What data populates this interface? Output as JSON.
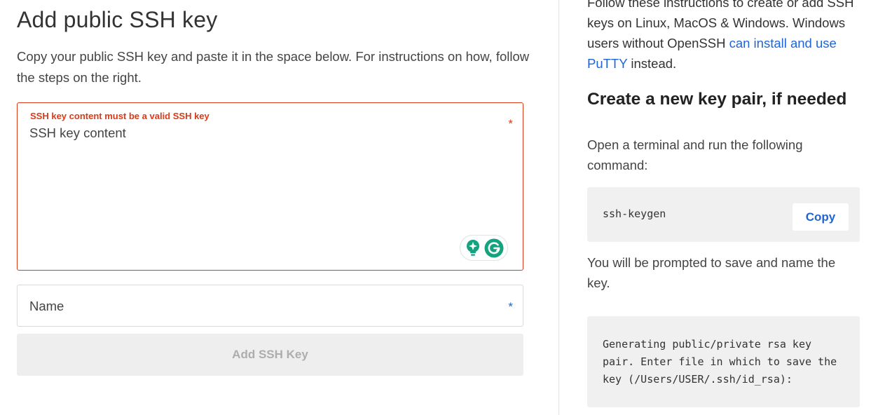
{
  "form": {
    "title": "Add public SSH key",
    "subtitle": "Copy your public SSH key and paste it in the space below. For instructions on how, follow the steps on the right.",
    "ssh_field": {
      "error": "SSH key content must be a valid SSH key",
      "placeholder": "SSH key content",
      "required_mark": "*"
    },
    "name_field": {
      "placeholder": "Name",
      "required_mark": "*"
    },
    "submit_label": "Add SSH Key"
  },
  "instructions": {
    "intro_text": "Follow these instructions to create or add SSH keys on Linux, MacOS & Windows. Windows users without OpenSSH",
    "intro_link": "can install and use PuTTY",
    "intro_suffix": "instead.",
    "section_heading": "Create a new key pair, if needed",
    "command_intro": "Open a terminal and run the following command:",
    "command": "ssh-keygen",
    "copy_label": "Copy",
    "prompt_text": "You will be prompted to save and name the key.",
    "output": "Generating public/private rsa key pair. Enter file in which to save the key (/Users/USER/.ssh/id_rsa):"
  },
  "colors": {
    "error": "#d93b18",
    "link": "#1f65d6",
    "required_name": "#1f65d6",
    "disabled_button_bg": "#eeeeee",
    "code_bg": "#f0f0f0",
    "grammarly": "#15a37f"
  },
  "icons": {
    "grammarly_bulb": "lightbulb-icon",
    "grammarly_logo": "grammarly-g-icon"
  }
}
